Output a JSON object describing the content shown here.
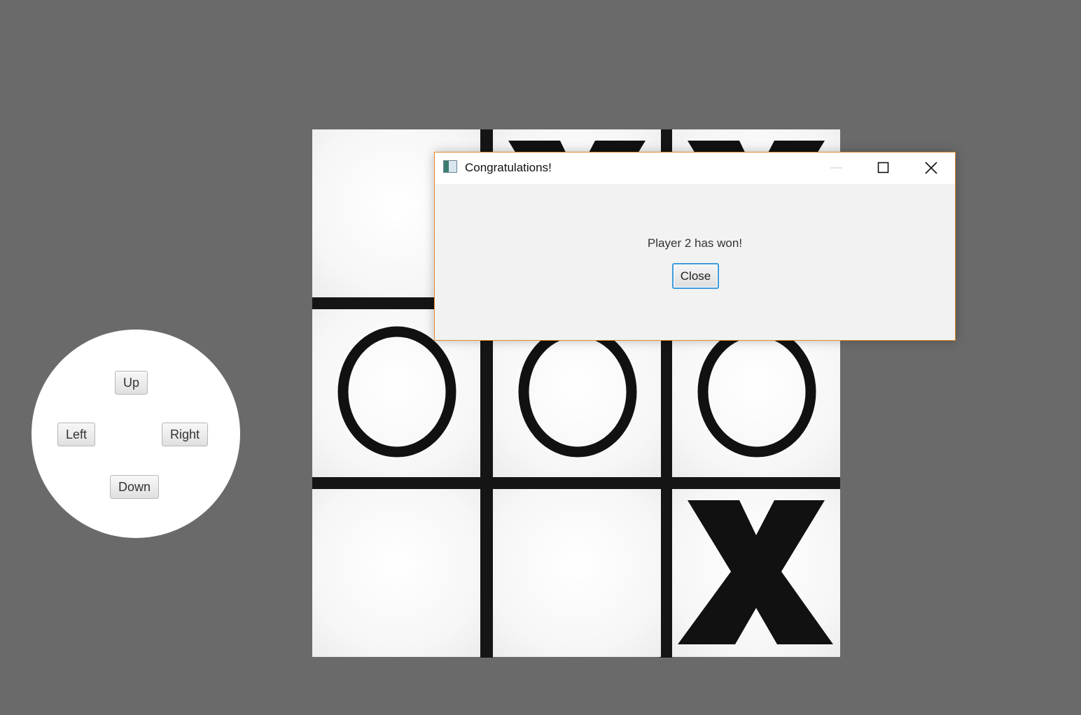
{
  "dpad": {
    "up_label": "Up",
    "left_label": "Left",
    "right_label": "Right",
    "down_label": "Down"
  },
  "board": {
    "cells": [
      [
        "",
        "X",
        "X"
      ],
      [
        "O",
        "O",
        "O"
      ],
      [
        "",
        "",
        "X"
      ]
    ]
  },
  "dialog": {
    "title": "Congratulations!",
    "message": "Player 2 has won!",
    "close_label": "Close",
    "controls": [
      "minimize-icon",
      "maximize-icon",
      "close-icon"
    ],
    "border_color": "#e68a2e",
    "focus_color": "#3d9ad9"
  },
  "colors": {
    "background": "#6a6a6a",
    "mark": "#111111",
    "tile": "#ffffff"
  }
}
